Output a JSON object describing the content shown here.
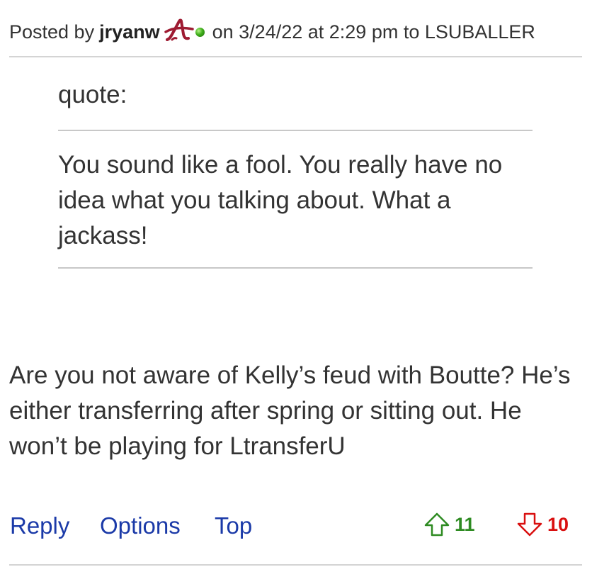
{
  "header": {
    "posted_by_prefix": "Posted by",
    "username": "jryanw",
    "posted_meta": "on 3/24/22 at 2:29 pm to LSUBALLER",
    "team_logo_icon": "alabama-script-a-icon",
    "online_status_icon": "online-dot-icon",
    "colors": {
      "team": "#9e1b32",
      "online": "#3fae1a"
    }
  },
  "quote": {
    "label": "quote:",
    "text": "You sound like a fool. You really have no idea what you talking about. What a jackass!"
  },
  "post": {
    "body": "Are you not aware of Kelly’s feud with Boutte? He’s either transferring after spring or sitting out. He won’t be playing for LtransferU"
  },
  "actions": {
    "reply": "Reply",
    "options": "Options",
    "top": "Top",
    "link_color": "#1b3aa8"
  },
  "votes": {
    "up_icon": "thumb-up-arrow-icon",
    "up_count": "11",
    "down_icon": "thumb-down-arrow-icon",
    "down_count": "10",
    "up_color": "#2e8b22",
    "down_color": "#d91010"
  }
}
